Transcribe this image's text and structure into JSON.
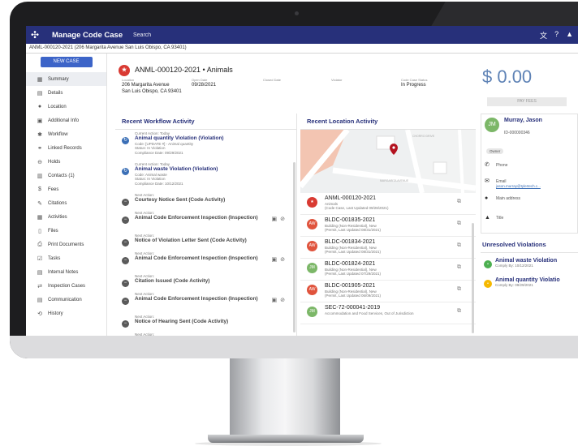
{
  "app": {
    "title": "Manage Code Case",
    "search_label": "Search"
  },
  "breadcrumb": "ANML-000120-2021 (206 Margarita Avenue San Luis Obispo, CA 93401)",
  "sidebar": {
    "new_case": "NEW CASE",
    "items": [
      {
        "label": "Summary",
        "icon": "summary-icon"
      },
      {
        "label": "Details",
        "icon": "details-icon"
      },
      {
        "label": "Location",
        "icon": "location-icon"
      },
      {
        "label": "Additional Info",
        "icon": "info-icon"
      },
      {
        "label": "Workflow",
        "icon": "workflow-icon"
      },
      {
        "label": "Linked Records",
        "icon": "link-icon"
      },
      {
        "label": "Holds",
        "icon": "holds-icon"
      },
      {
        "label": "Contacts (1)",
        "icon": "contacts-icon"
      },
      {
        "label": "Fees",
        "icon": "fees-icon"
      },
      {
        "label": "Citations",
        "icon": "citations-icon"
      },
      {
        "label": "Activities",
        "icon": "activities-icon"
      },
      {
        "label": "Files",
        "icon": "files-icon"
      },
      {
        "label": "Print Documents",
        "icon": "print-icon"
      },
      {
        "label": "Tasks",
        "icon": "tasks-icon"
      },
      {
        "label": "Internal Notes",
        "icon": "notes-icon"
      },
      {
        "label": "Inspection Cases",
        "icon": "inspection-icon"
      },
      {
        "label": "Communication",
        "icon": "communication-icon"
      },
      {
        "label": "History",
        "icon": "history-icon"
      }
    ]
  },
  "case": {
    "title": "ANML-000120-2021 • Animals",
    "location_label": "Location",
    "location_line1": "206 Margarita Avenue",
    "location_line2": "San Luis Obispo, CA 93401",
    "open_date_label": "Open Date",
    "open_date": "09/28/2021",
    "closed_date_label": "Closed Date",
    "violator_label": "Violator",
    "status_label": "Code Case Status",
    "status": "In Progress"
  },
  "fees": {
    "amount": "$ 0.00",
    "pay_label": "PAY FEES"
  },
  "workflow": {
    "title": "Recent Workflow Activity",
    "current": [
      {
        "small": "Current Action: Today",
        "title": "Animal quantity Violation (Violation)",
        "line1": "Code: [UPDATE #] - Animal quantity",
        "line2": "Status: In Violation",
        "line3": "Compliance Date: 09/29/2021"
      },
      {
        "small": "Current Action: Today",
        "title": "Animal waste Violation (Violation)",
        "line1": "Code: Animal waste",
        "line2": "Status: In Violation",
        "line3": "Compliance Date: 10/12/2021"
      }
    ],
    "next_label": "Next Action:",
    "next": [
      "Courtesy Notice Sent (Code Activity)",
      "Animal Code Enforcement Inspection (Inspection)",
      "Notice of Violation Letter Sent (Code Activity)",
      "Animal Code Enforcement Inspection (Inspection)",
      "Citation Issued (Code Activity)",
      "Animal Code Enforcement Inspection (Inspection)",
      "Notice of Hearing Sent (Code Activity)"
    ],
    "partial": "Next Action:"
  },
  "location": {
    "title": "Recent Location Activity",
    "map_streets": [
      "CHORRO DRIVE",
      "MARGARITA AVENUE"
    ],
    "items": [
      {
        "badge": "ANML",
        "title": "ANML-000120-2021",
        "line1": "Animals",
        "line2": "(Code Case, Last Updated 09/28/2021)"
      },
      {
        "badge": "AW",
        "title": "BLDC-001835-2021",
        "line1": "Building (Non-Residential), New",
        "line2": "(Permit, Last Updated 08/31/2021)"
      },
      {
        "badge": "AW",
        "title": "BLDC-001834-2021",
        "line1": "Building (Non-Residential), New",
        "line2": "(Permit, Last Updated 08/31/2021)"
      },
      {
        "badge": "JM",
        "title": "BLDC-001824-2021",
        "line1": "Building (Non-Residential), New",
        "line2": "(Permit, Last Updated 07/29/2021)"
      },
      {
        "badge": "AW",
        "title": "BLDC-001905-2021",
        "line1": "Building (Non-Residential), New",
        "line2": "(Permit, Last Updated 06/09/2021)"
      },
      {
        "badge": "JM",
        "title": "SEC-72-000041-2019",
        "line1": "Accommodation and Food Services, Out of Jurisdiction",
        "line2": ""
      }
    ]
  },
  "contact": {
    "initials": "JM",
    "name": "Murray, Jason",
    "id": "ID-000000346",
    "role": "Owner",
    "phone_label": "Phone",
    "email_label": "Email",
    "email": "jason.murray@tylertech.c...",
    "address_label": "Main address",
    "title_label": "Title"
  },
  "violations": {
    "title": "Unresolved Violations",
    "items": [
      {
        "title": "Animal waste Violation",
        "sub": "Comply By: 10/12/2021",
        "color": "#4caf50"
      },
      {
        "title": "Animal quantity Violatio",
        "sub": "Comply By: 09/29/2021",
        "color": "#f5b800"
      }
    ]
  },
  "colors": {
    "brand": "#27307a",
    "accent": "#3c64c8",
    "danger": "#d93a32",
    "ok": "#7cb768"
  }
}
